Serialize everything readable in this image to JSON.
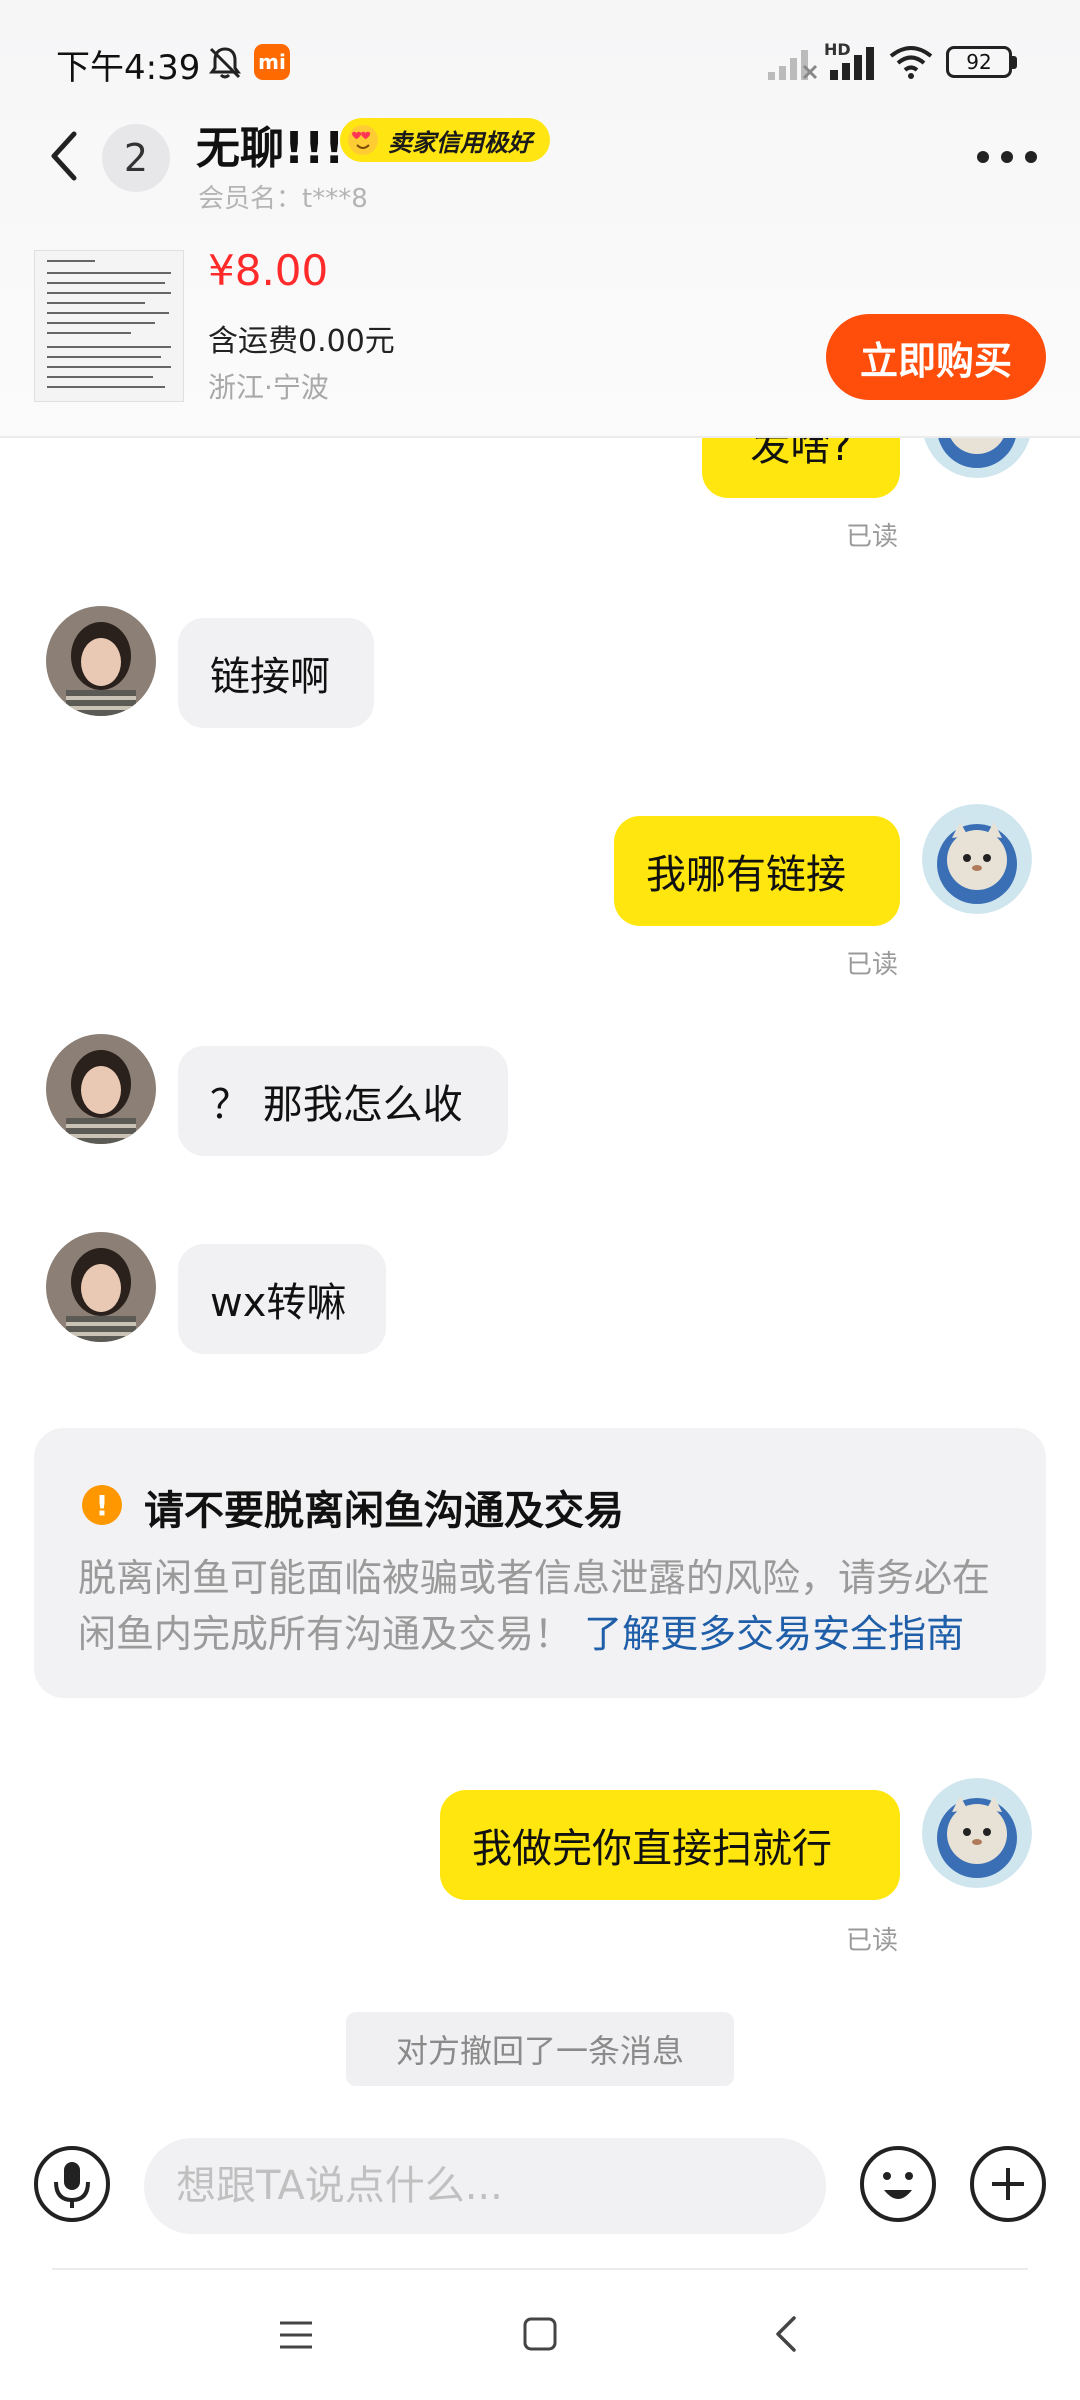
{
  "status_bar": {
    "time": "下午4:39",
    "mi_badge": "mi",
    "network_label": "HD",
    "battery": "92"
  },
  "header": {
    "unread_count": "2",
    "contact_name": "无聊!!!",
    "credit_badge": "卖家信用极好",
    "member_name": "会员名：t***8"
  },
  "product": {
    "price": "¥8.00",
    "shipping": "含运费0.00元",
    "location": "浙江·宁波",
    "buy_label": "立即购买"
  },
  "messages": [
    {
      "side": "mine",
      "text": "发啥?",
      "read": "已读"
    },
    {
      "side": "theirs",
      "text": "链接啊"
    },
    {
      "side": "mine",
      "text": "我哪有链接",
      "read": "已读"
    },
    {
      "side": "theirs",
      "text": "？ 那我怎么收"
    },
    {
      "side": "theirs",
      "text": "wx转嘛"
    },
    {
      "side": "mine",
      "text": "我做完你直接扫就行",
      "read": "已读"
    }
  ],
  "notice": {
    "title": "请不要脱离闲鱼沟通及交易",
    "body": "脱离闲鱼可能面临被骗或者信息泄露的风险，请务必在闲鱼内完成所有沟通及交易！",
    "link": "了解更多交易安全指南"
  },
  "system_message": "对方撤回了一条消息",
  "input": {
    "placeholder": "想跟TA说点什么..."
  },
  "colors": {
    "my_bubble": "#ffe60f",
    "their_bubble": "#f1f1f3",
    "buy_button": "#ff4d0b",
    "price": "#ff2a2a",
    "credit_badge": "#ffe512",
    "notice_link": "#1f5ea8",
    "notice_icon": "#ff9800"
  },
  "icons": {
    "back": "chevron-left-icon",
    "more": "more-dots-icon",
    "mic": "microphone-icon",
    "emoji": "smiley-icon",
    "plus": "plus-icon",
    "notice": "exclamation-icon"
  }
}
